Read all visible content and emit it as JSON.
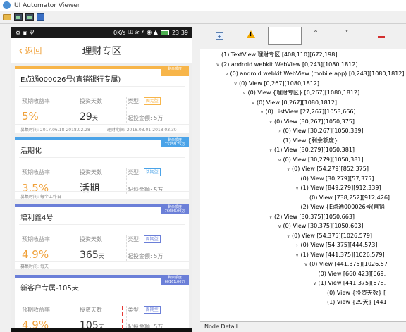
{
  "window": {
    "title": "UI Automator Viewer"
  },
  "toolbar": {
    "icons": [
      "open-folder-icon",
      "device-screenshot-icon",
      "device-screenshot-compressed-icon",
      "save-icon"
    ]
  },
  "phone": {
    "status": {
      "left": "⚙ ▣ Ψ",
      "network": "0K/s",
      "indicators": "⚿ ✰ ⚡ ◉ ▲",
      "time": "23:39"
    },
    "header": {
      "back_label": "返回",
      "title": "理财专区"
    },
    "products": [
      {
        "name": "E点通000026号(直销银行专属)",
        "band_color": "#f7b54a",
        "ribbon": "剩余额度",
        "rate_label": "预期收益率",
        "rate": "5%",
        "days_label": "投资天数",
        "days": "29",
        "days_unit": "天",
        "type_label": "类型:",
        "type_tag": "固定型",
        "tag_color": "#f7b54a",
        "min_label": "起投金额:",
        "min_amount": "5万",
        "footer_left": "募集时间: 2017.06.18-2018.02.28",
        "footer_right": "理财期间: 2018.03.01-2018.03.30"
      },
      {
        "name": "活期化",
        "band_color": "#4aa3e8",
        "ribbon": "剩余额度 73758.75万",
        "rate_label": "预期收益率",
        "rate": "3.5%",
        "days_label": "投资天数",
        "days": "活期",
        "days_unit": "",
        "type_label": "类型:",
        "type_tag": "活期型",
        "tag_color": "#4aa3e8",
        "min_label": "起投金额:",
        "min_amount": "5万",
        "footer_left": "募集时间: 每个工作日",
        "footer_right": ""
      },
      {
        "name": "增利鑫4号",
        "band_color": "#6b7fd8",
        "ribbon": "剩余额度 76686.00万",
        "rate_label": "预期收益率",
        "rate": "4.9%",
        "days_label": "投资天数",
        "days": "365",
        "days_unit": "天",
        "type_label": "类型:",
        "type_tag": "周期型",
        "tag_color": "#6b7fd8",
        "min_label": "起投金额:",
        "min_amount": "5万",
        "footer_left": "募集时间: 每天",
        "footer_right": ""
      },
      {
        "name": "新客户专属-105天",
        "band_color": "#6b7fd8",
        "ribbon": "剩余额度 60161.00万",
        "rate_label": "预期收益率",
        "rate": "4.9%",
        "days_label": "投资天数",
        "days": "105",
        "days_unit": "天",
        "type_label": "类型:",
        "type_tag": "周期型",
        "tag_color": "#6b7fd8",
        "min_label": "起投金额:",
        "min_amount": "5万",
        "footer_left": "",
        "footer_right": ""
      }
    ]
  },
  "hierarchy": {
    "toolbar": {
      "expand_label": "+",
      "warn_label": "!",
      "up_label": "˄",
      "down_label": "˅"
    },
    "nodes": [
      {
        "depth": 1,
        "chev": "",
        "text": "(1) TextView:理财专区 [408,110][672,198]"
      },
      {
        "depth": 1,
        "chev": "∨",
        "text": "(2) android.webkit.WebView [0,243][1080,1812]"
      },
      {
        "depth": 2,
        "chev": "∨",
        "text": "(0) android.webkit.WebView (mobile app) [0,243][1080,1812]"
      },
      {
        "depth": 3,
        "chev": "∨",
        "text": "(0) View [0,267][1080,1812]"
      },
      {
        "depth": 4,
        "chev": "∨",
        "text": "(0) View {理财专区} [0,267][1080,1812]"
      },
      {
        "depth": 5,
        "chev": "∨",
        "text": "(0) View [0,267][1080,1812]"
      },
      {
        "depth": 6,
        "chev": "∨",
        "text": "(0) ListView [27,267][1053,666]"
      },
      {
        "depth": 7,
        "chev": "∨",
        "text": "(0) View [30,267][1050,375]"
      },
      {
        "depth": 8,
        "chev": "›",
        "text": "(0) View [30,267][1050,339]"
      },
      {
        "depth": 8,
        "chev": "",
        "text": "(1) View {剩余额度}"
      },
      {
        "depth": 7,
        "chev": "∨",
        "text": "(1) View [30,279][1050,381]"
      },
      {
        "depth": 8,
        "chev": "∨",
        "text": "(0) View [30,279][1050,381]"
      },
      {
        "depth": 9,
        "chev": "∨",
        "text": "(0) View [54,279][852,375]"
      },
      {
        "depth": 10,
        "chev": "",
        "text": "(0) View [30,279][57,375]"
      },
      {
        "depth": 10,
        "chev": "∨",
        "text": "(1) View [849,279][912,339]"
      },
      {
        "depth": 11,
        "chev": "",
        "text": "(0) View [738,252][912,426]"
      },
      {
        "depth": 10,
        "chev": "",
        "text": "(2) View {E点通000026号(直销"
      },
      {
        "depth": 7,
        "chev": "∨",
        "text": "(2) View [30,375][1050,663]"
      },
      {
        "depth": 8,
        "chev": "∨",
        "text": "(0) View [30,375][1050,603]"
      },
      {
        "depth": 9,
        "chev": "∨",
        "text": "(0) View [54,375][1026,579]"
      },
      {
        "depth": 10,
        "chev": "›",
        "text": "(0) View [54,375][444,573]"
      },
      {
        "depth": 10,
        "chev": "∨",
        "text": "(1) View [441,375][1026,579]"
      },
      {
        "depth": 11,
        "chev": "∨",
        "text": "(0) View [441,375][1026,57"
      },
      {
        "depth": 12,
        "chev": "",
        "text": "(0) View [660,423][669,"
      },
      {
        "depth": 12,
        "chev": "∨",
        "text": "(1) View [441,375][678,"
      },
      {
        "depth": 13,
        "chev": "",
        "text": "(0) View {投资天数} ["
      },
      {
        "depth": 13,
        "chev": "",
        "text": "(1) View {29天} [441"
      }
    ]
  },
  "node_detail": {
    "title": "Node Detail"
  }
}
